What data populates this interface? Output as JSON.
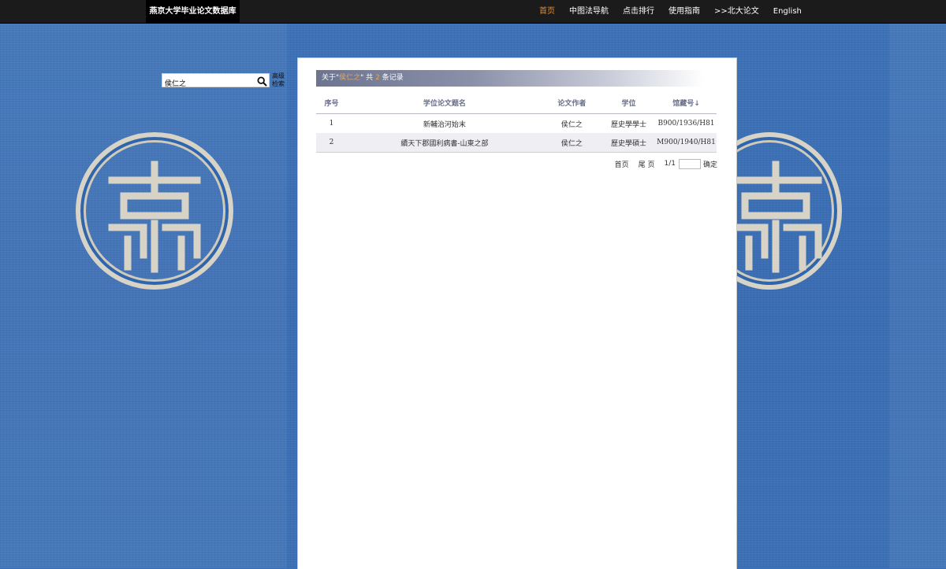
{
  "header": {
    "site_title": "燕京大学毕业论文数据库",
    "nav": [
      "首页",
      "中图法导航",
      "点击排行",
      "使用指南",
      ">>北大论文",
      "English"
    ],
    "active_index": 0
  },
  "search": {
    "value": "侯仁之",
    "advanced_label_line1": "高级",
    "advanced_label_line2": "检索"
  },
  "results": {
    "prefix": "关于\"",
    "keyword": "侯仁之",
    "middle": "\" 共 ",
    "count": "2",
    "suffix": " 条记录",
    "columns": [
      "序号",
      "学位论文题名",
      "论文作者",
      "学位",
      "馆藏号↓"
    ],
    "rows": [
      [
        "1",
        "新輔治河始末",
        "侯仁之",
        "歷史學學士",
        "B900/1936/H81"
      ],
      [
        "2",
        "續天下郡國利病書-山東之部",
        "侯仁之",
        "歷史學碩士",
        "M900/1940/H81"
      ]
    ]
  },
  "pager": {
    "first": "首页",
    "last": "尾 页",
    "page": "1/1",
    "go": "确定"
  },
  "colors": {
    "nav_active": "#f08a24",
    "keyword": "#f3a247",
    "background": "#3a6fb5"
  }
}
